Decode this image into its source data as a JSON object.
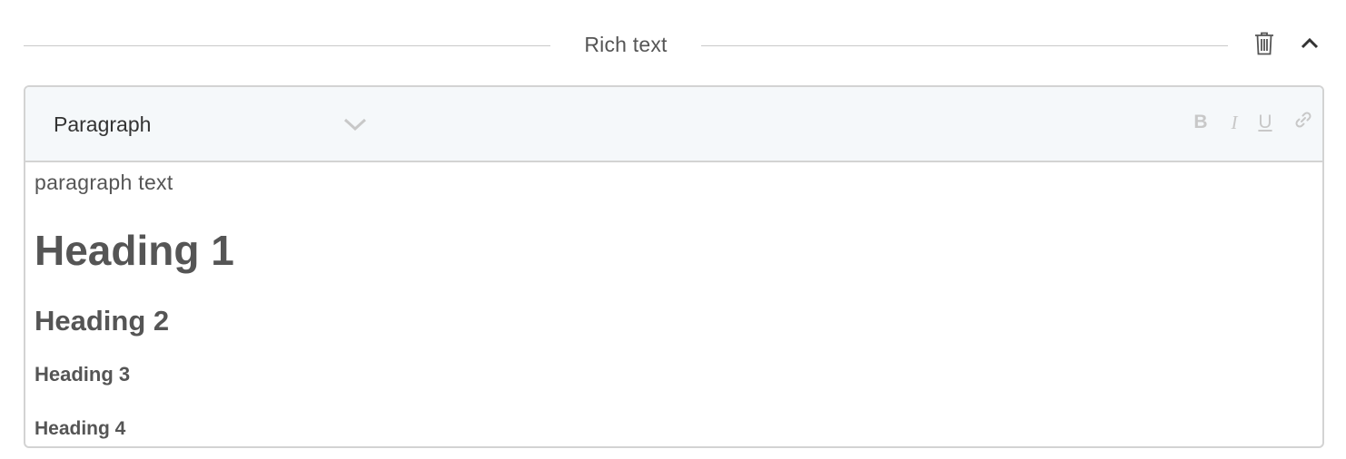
{
  "section": {
    "title": "Rich text",
    "delete_icon": "trash-icon",
    "collapse_icon": "chevron-up-icon"
  },
  "toolbar": {
    "block_type": "Paragraph",
    "block_type_icon": "chevron-down-icon",
    "bold_label": "B",
    "italic_label": "I",
    "underline_label": "U",
    "link_icon": "link-icon"
  },
  "content": {
    "paragraph": "paragraph text",
    "h1": "Heading 1",
    "h2": "Heading 2",
    "h3": "Heading 3",
    "h4": "Heading 4"
  },
  "colors": {
    "text": "#555555",
    "toolbar_bg": "#f5f8fa",
    "border": "#d3d3d3",
    "disabled_icon": "#c8c8c8"
  }
}
